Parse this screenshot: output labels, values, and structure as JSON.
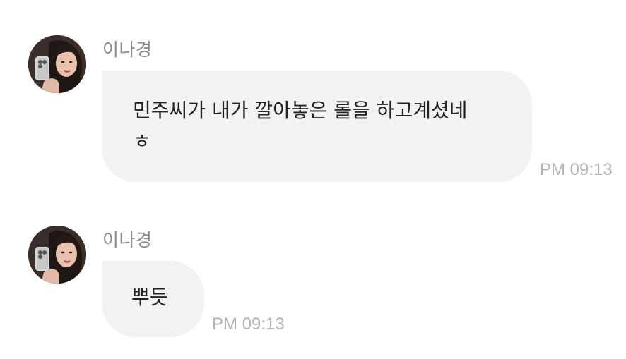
{
  "messages": [
    {
      "sender": "이나경",
      "lines": [
        "민주씨가 내가 깔아놓은 롤을 하고계셨네",
        "ㅎ"
      ],
      "time": "PM 09:13"
    },
    {
      "sender": "이나경",
      "lines": [
        "뿌듯"
      ],
      "time": "PM 09:13"
    }
  ],
  "colors": {
    "background": "#ffffff",
    "bubble": "#f2f2f4",
    "sender_name": "#8a8a8e",
    "timestamp": "#b4b4b8",
    "message_text": "#222222"
  }
}
